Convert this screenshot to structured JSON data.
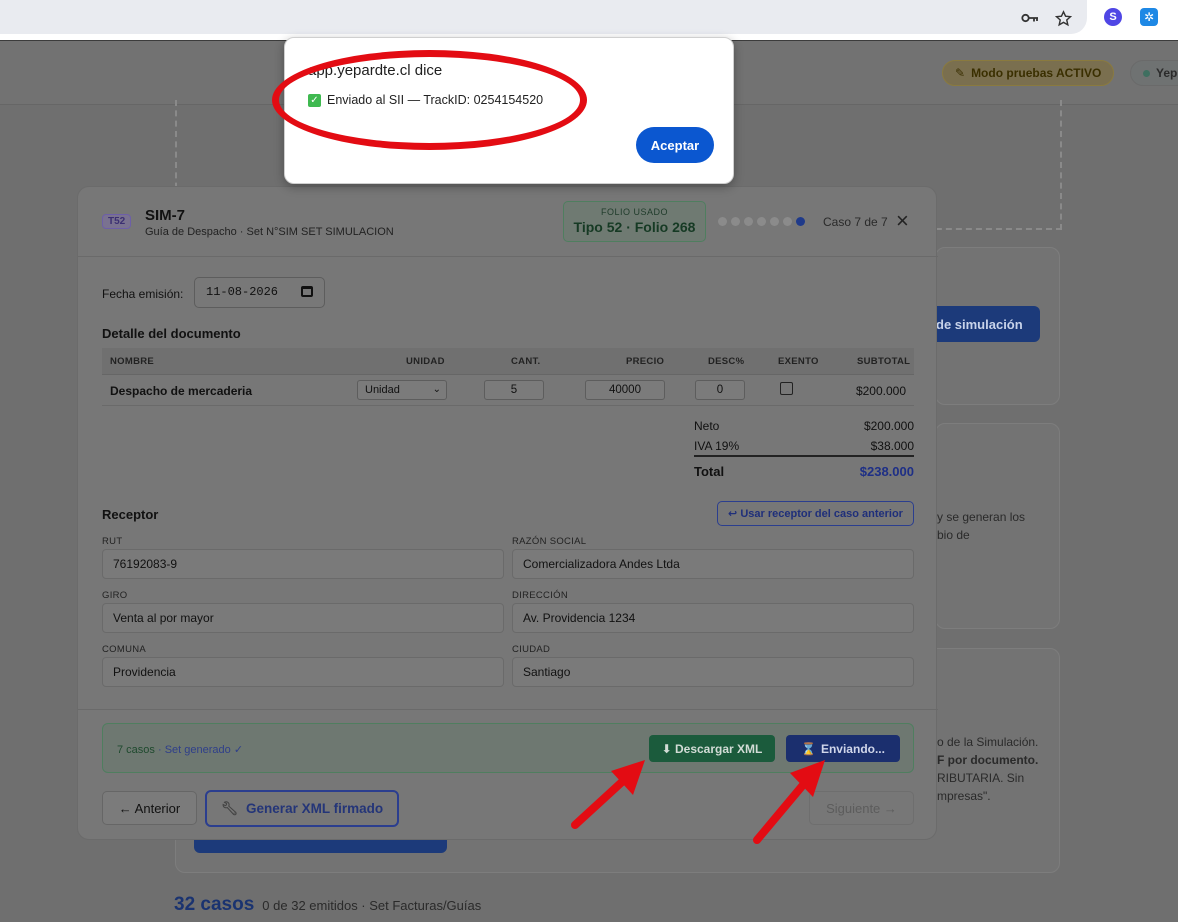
{
  "browser": {
    "ext_s_letter": "S",
    "ext_b_icon": "snowflake-icon"
  },
  "background": {
    "mode_pill": "Modo pruebas ACTIVO",
    "brand_pill": "Yep",
    "sim_button": "de simulación",
    "text_a_1": "y se generan los",
    "text_a_2": "bio de",
    "text_b_1": "o de la Simulación.",
    "text_b_2": "F por documento.",
    "text_b_3": "RIBUTARIA. Sin",
    "text_b_4": "mpresas\".",
    "casos_count": "32 casos",
    "casos_detail": "0 de 32 emitidos · Set Facturas/Guías"
  },
  "modal": {
    "tag": "T52",
    "title": "SIM-7",
    "subtitle": "Guía de Despacho · Set N°SIM SET SIMULACION",
    "folio_label": "FOLIO USADO",
    "folio_value": "Tipo 52 · Folio 268",
    "step_total": 7,
    "step_current": 7,
    "case_count": "Caso 7 de 7",
    "close_icon": "×",
    "fecha_label": "Fecha emisión:",
    "fecha_value": "11-08-2026",
    "detalle_title": "Detalle del documento",
    "columns": {
      "nombre": "NOMBRE",
      "unidad": "UNIDAD",
      "cant": "CANT.",
      "precio": "PRECIO",
      "desc": "DESC%",
      "exento": "EXENTO",
      "subtotal": "SUBTOTAL"
    },
    "item": {
      "nombre": "Despacho de mercaderia",
      "unidad": "Unidad",
      "cant": "5",
      "precio": "40000",
      "desc": "0",
      "exento": false,
      "subtotal": "$200.000"
    },
    "totals": {
      "neto_label": "Neto",
      "neto_value": "$200.000",
      "iva_label": "IVA 19%",
      "iva_value": "$38.000",
      "total_label": "Total",
      "total_value": "$238.000"
    },
    "receptor_title": "Receptor",
    "use_prev_button": "↩ Usar receptor del caso anterior",
    "fields": {
      "rut_label": "RUT",
      "rut_value": "76192083-9",
      "razon_label": "RAZÓN SOCIAL",
      "razon_value": "Comercializadora Andes Ltda",
      "giro_label": "GIRO",
      "giro_value": "Venta al por mayor",
      "direccion_label": "DIRECCIÓN",
      "direccion_value": "Av. Providencia 1234",
      "comuna_label": "COMUNA",
      "comuna_value": "Providencia",
      "ciudad_label": "CIUDAD",
      "ciudad_value": "Santiago"
    },
    "status": {
      "casos": "7 casos",
      "set": "· Set generado ✓"
    },
    "download_button": "⬇ Descargar XML",
    "sending_button": "Enviando...",
    "prev_button": "← Anterior",
    "generate_button": "Generar XML firmado",
    "next_button": "Siguiente →"
  },
  "dialog": {
    "title": "app.yepardte.cl dice",
    "message": "Enviado al SII — TrackID: 0254154520",
    "accept_button": "Aceptar"
  },
  "colors": {
    "accent_blue": "#0b57d0",
    "annotation_red": "#e30c13",
    "success_green": "#3fb950"
  }
}
